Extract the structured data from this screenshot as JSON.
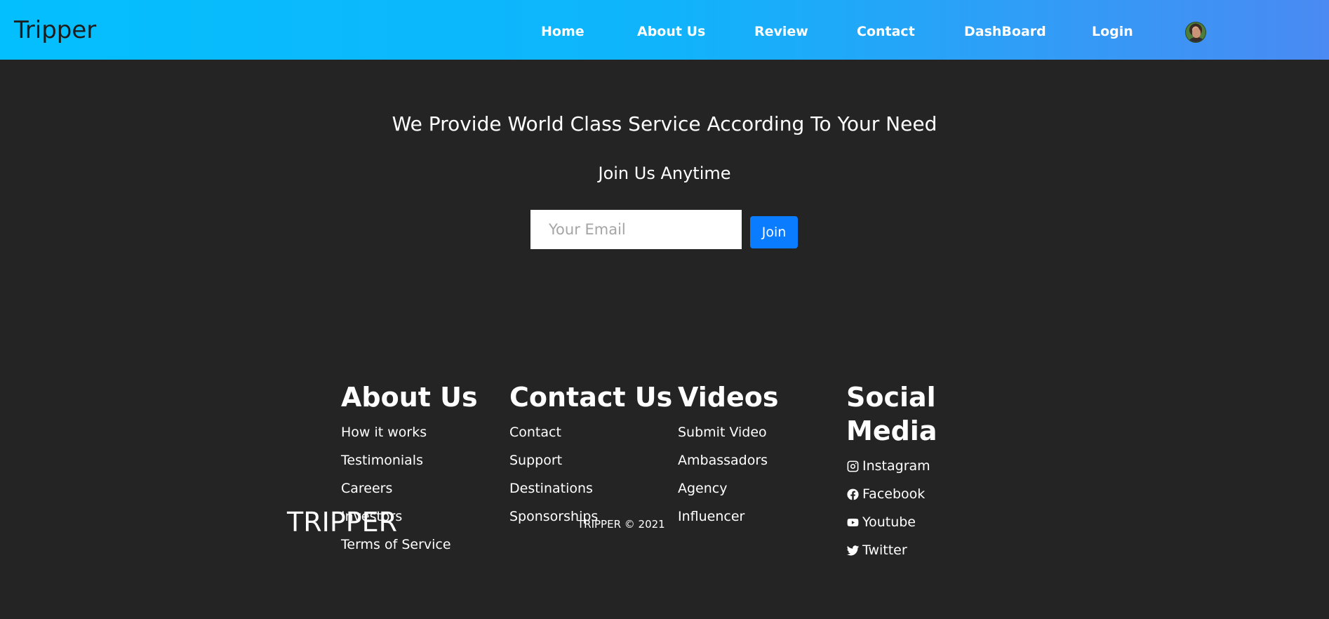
{
  "nav": {
    "brand": "Tripper",
    "links": [
      "Home",
      "About Us",
      "Review",
      "Contact",
      "DashBoard",
      "Login"
    ]
  },
  "hero": {
    "tagline": "We Provide World Class Service According To Your Need",
    "join_title": "Join Us Anytime",
    "email_placeholder": "Your Email",
    "join_button": "Join"
  },
  "footer": {
    "about": {
      "heading": "About Us",
      "links": [
        "How it works",
        "Testimonials",
        "Careers",
        "Investors",
        "Terms of Service"
      ]
    },
    "contact": {
      "heading": "Contact Us",
      "links": [
        "Contact",
        "Support",
        "Destinations",
        "Sponsorships"
      ]
    },
    "videos": {
      "heading": "Videos",
      "links": [
        "Submit Video",
        "Ambassadors",
        "Agency",
        "Influencer"
      ]
    },
    "social": {
      "heading_line1": "Social",
      "heading_line2": "Media",
      "links": [
        {
          "label": "Instagram",
          "icon": "instagram-icon"
        },
        {
          "label": "Facebook",
          "icon": "facebook-icon"
        },
        {
          "label": "Youtube",
          "icon": "youtube-icon"
        },
        {
          "label": "Twitter",
          "icon": "twitter-icon"
        }
      ]
    },
    "brand": "TRIPPER",
    "copyright": "TRIPPER © 2021"
  }
}
